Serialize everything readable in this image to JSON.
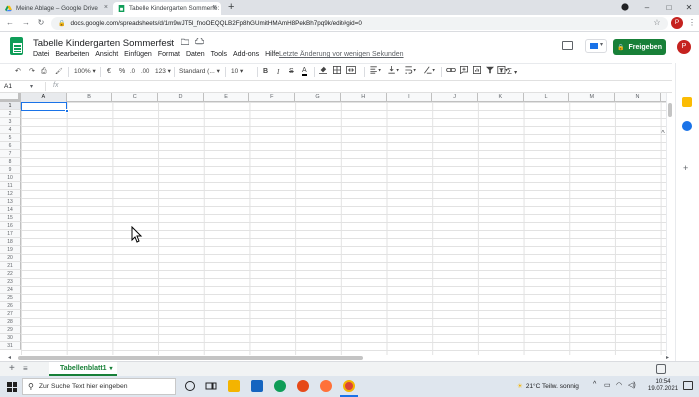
{
  "browser": {
    "tabs": [
      {
        "label": "Meine Ablage – Google Drive",
        "close": "×"
      },
      {
        "label": "Tabelle Kindergarten Sommerfe:",
        "close": "×"
      }
    ],
    "new_tab": "+",
    "window_controls": {
      "minimize": "–",
      "maximize": "□",
      "close": "✕"
    },
    "url": "docs.google.com/spreadsheets/d/1m9wJT5l_fnoOEQQLB2Fp8hGUmitHMAmH8PekBh7pq9k/edit#gid=0",
    "profile_initial": "P"
  },
  "sheets": {
    "title": "Tabelle Kindergarten Sommerfest",
    "menu": [
      "Datei",
      "Bearbeiten",
      "Ansicht",
      "Einfügen",
      "Format",
      "Daten",
      "Tools",
      "Add-ons",
      "Hilfe"
    ],
    "last_edit": "Letzte Änderung vor wenigen Sekunden",
    "share_label": "Freigeben",
    "avatar_initial": "P"
  },
  "toolbar": {
    "undo": "↶",
    "redo": "↷",
    "print": "⎙",
    "paint_format": "🖌",
    "zoom": "100%",
    "zoom_caret": "▾",
    "currency": "€",
    "percent": "%",
    "decimal_less": ".0",
    "decimal_more": ".00",
    "more_formats": "123",
    "font": "Standard (...",
    "font_size": "10",
    "bold": "B",
    "italic": "I",
    "strike": "S",
    "text_color": "A",
    "collapse": "^"
  },
  "formula_bar": {
    "cell_ref": "A1",
    "fx": "fx"
  },
  "grid": {
    "columns": [
      "A",
      "B",
      "C",
      "D",
      "E",
      "F",
      "G",
      "H",
      "I",
      "J",
      "K",
      "L",
      "M",
      "N"
    ],
    "rows": [
      "1",
      "2",
      "3",
      "4",
      "5",
      "6",
      "7",
      "8",
      "9",
      "10",
      "11",
      "12",
      "13",
      "14",
      "15",
      "16",
      "17",
      "18",
      "19",
      "20",
      "21",
      "22",
      "23",
      "24",
      "25",
      "26",
      "27",
      "28",
      "29",
      "30",
      "31"
    ]
  },
  "sheet_tabs": {
    "add": "+",
    "all": "≡",
    "active": "Tabellenblatt1",
    "caret": "▾"
  },
  "taskbar": {
    "search_placeholder": "Zur Suche Text hier eingeben",
    "weather": "21°C  Teilw. sonnig",
    "time": "10:54",
    "date": "19.07.2021"
  },
  "colors": {
    "sheets_green": "#0f9d58",
    "share_green": "#188038",
    "selection_blue": "#1a73e8"
  }
}
